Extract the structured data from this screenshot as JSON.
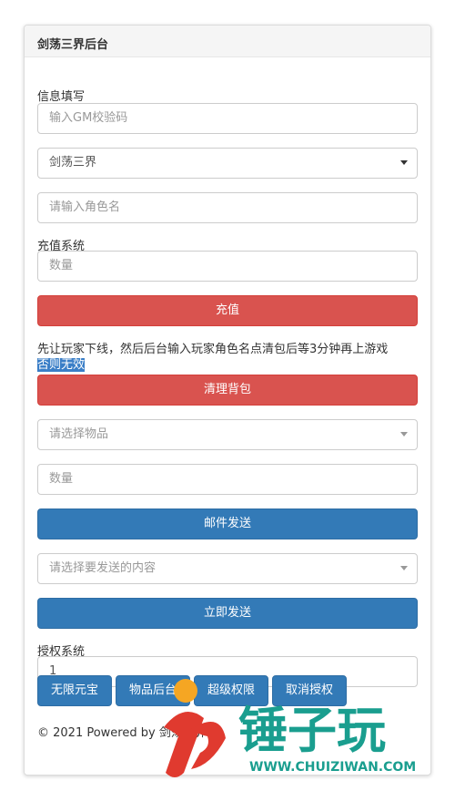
{
  "header": {
    "title": "剑荡三界后台"
  },
  "info": {
    "label": "信息填写",
    "gm_code_placeholder": "输入GM校验码",
    "server_selected": "剑荡三界",
    "role_placeholder": "请输入角色名"
  },
  "recharge": {
    "label": "充值系统",
    "amount_placeholder": "数量",
    "button": "充值"
  },
  "clear": {
    "notice_line1": "先让玩家下线，然后后台输入玩家角色名点清包后等3分钟再上游戏",
    "notice_line2": "否则无效",
    "button": "清理背包"
  },
  "mail": {
    "item_placeholder": "请选择物品",
    "quantity_placeholder": "数量",
    "button": "邮件发送"
  },
  "send": {
    "content_placeholder": "请选择要发送的内容",
    "button": "立即发送"
  },
  "auth": {
    "label": "授权系统",
    "value": "1",
    "buttons": [
      "无限元宝",
      "物品后台",
      "超级权限",
      "取消授权"
    ]
  },
  "footer": {
    "text": "© 2021 Powered by 剑荡三界"
  },
  "watermark": {
    "text": "锤子玩",
    "url": "WWW.CHUIZIWAN.COM"
  },
  "colors": {
    "danger": "#d9534f",
    "primary": "#337ab7",
    "highlight": "#3a7ec7",
    "watermark_orange": "#f5a623",
    "watermark_red": "#e03a2f",
    "watermark_teal": "#1a9e8f"
  }
}
